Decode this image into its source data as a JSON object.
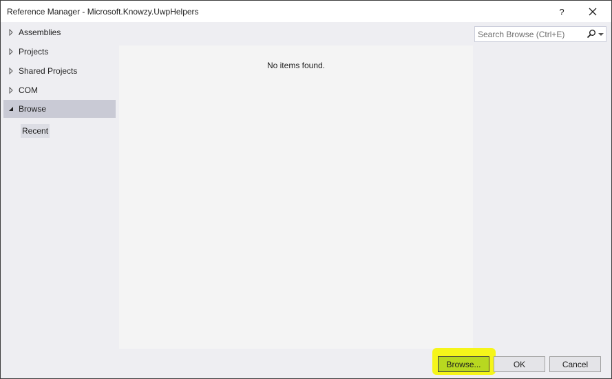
{
  "window": {
    "title": "Reference Manager - Microsoft.Knowzy.UwpHelpers",
    "help_label": "?",
    "close_icon": "close-icon"
  },
  "nav": {
    "items": [
      {
        "label": "Assemblies",
        "expanded": false,
        "selected": false
      },
      {
        "label": "Projects",
        "expanded": false,
        "selected": false
      },
      {
        "label": "Shared Projects",
        "expanded": false,
        "selected": false
      },
      {
        "label": "COM",
        "expanded": false,
        "selected": false
      },
      {
        "label": "Browse",
        "expanded": true,
        "selected": true
      }
    ],
    "sub_item": {
      "label": "Recent"
    }
  },
  "content": {
    "empty_message": "No items found."
  },
  "search": {
    "placeholder": "Search Browse (Ctrl+E)",
    "value": ""
  },
  "footer": {
    "browse_label": "Browse...",
    "ok_label": "OK",
    "cancel_label": "Cancel"
  },
  "colors": {
    "highlight": "#f5f51a",
    "selected_nav": "#c9cad5",
    "background": "#eeeef2"
  }
}
